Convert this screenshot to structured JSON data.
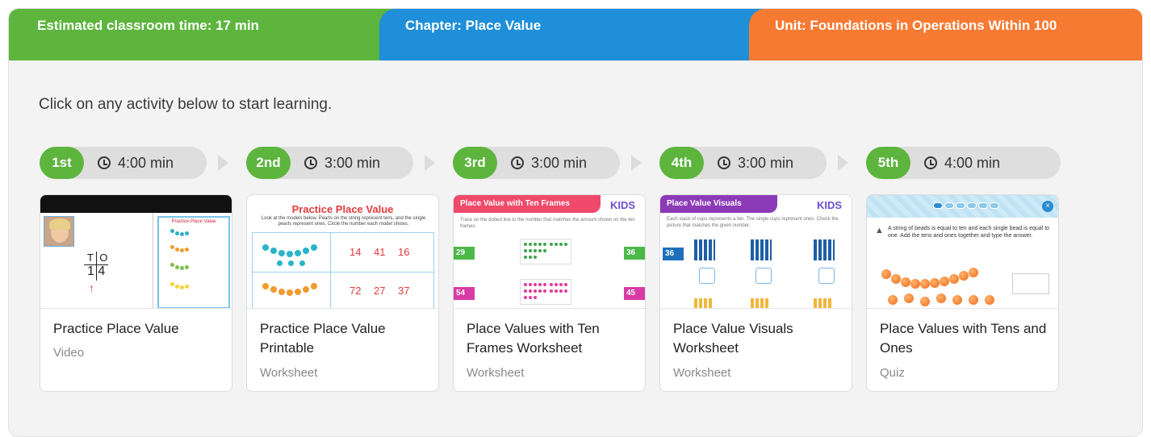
{
  "header": {
    "time_label": "Estimated classroom time: 17 min",
    "chapter_label": "Chapter: Place Value",
    "unit_label": "Unit: Foundations in Operations Within 100",
    "colors": {
      "time": "#5db53e",
      "chapter": "#1e8fd8",
      "unit": "#f77a33"
    }
  },
  "intro": "Click on any activity below to start learning.",
  "steps": [
    {
      "order": "1st",
      "duration": "4:00 min"
    },
    {
      "order": "2nd",
      "duration": "3:00 min"
    },
    {
      "order": "3rd",
      "duration": "3:00 min"
    },
    {
      "order": "4th",
      "duration": "3:00 min"
    },
    {
      "order": "5th",
      "duration": "4:00 min"
    }
  ],
  "activities": [
    {
      "title": "Practice Place Value",
      "type": "Video",
      "thumb": {
        "sheet_title": "Practice Place Value",
        "tens_label": "T",
        "ones_label": "O",
        "number": "1 4",
        "arrow": "↑"
      }
    },
    {
      "title": "Practice Place Value Printable",
      "type": "Worksheet",
      "thumb": {
        "heading": "Practice Place Value",
        "subtext": "Look at the models below. Pearls on the string represent tens, and the single pearls represent ones. Circle the number each model shows.",
        "row1": [
          "14",
          "41",
          "16"
        ],
        "row2": [
          "72",
          "27",
          "37"
        ]
      }
    },
    {
      "title": "Place Values with Ten Frames Worksheet",
      "type": "Worksheet",
      "thumb": {
        "heading": "Place Value with Ten Frames",
        "logo": "KIDS",
        "subtext": "Trace on the dotted line to the number that matches the amount shown on the ten frames.",
        "left_numbers": [
          "29",
          "54"
        ],
        "right_numbers": [
          "36",
          "45"
        ]
      }
    },
    {
      "title": "Place Value Visuals Worksheet",
      "type": "Worksheet",
      "thumb": {
        "heading": "Place Value Visuals",
        "logo": "KIDS",
        "subtext": "Each stack of cups represents a ten. The single cups represent ones. Check the picture that matches the given number.",
        "number": "36"
      }
    },
    {
      "title": "Place Values with Tens and Ones",
      "type": "Quiz",
      "thumb": {
        "question": "A string of beads is equal to ten and each single bead is equal to one. Add the tens and ones together and type the answer.",
        "speaker_icon": "speaker-icon",
        "close_icon": "×"
      }
    }
  ]
}
